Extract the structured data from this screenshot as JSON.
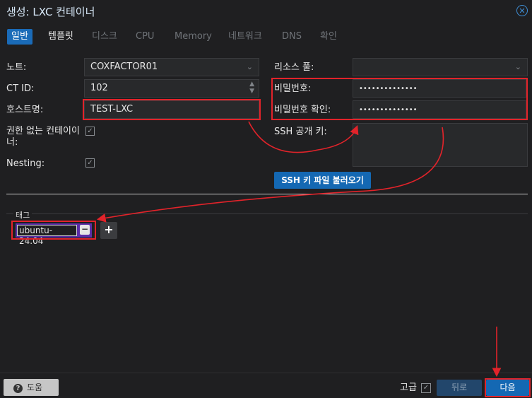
{
  "window": {
    "title": "생성: LXC 컨테이너"
  },
  "tabs": [
    {
      "label": "일반",
      "active": true
    },
    {
      "label": "템플릿",
      "active": false
    },
    {
      "label": "디스크",
      "active": false
    },
    {
      "label": "CPU",
      "active": false
    },
    {
      "label": "Memory",
      "active": false
    },
    {
      "label": "네트워크",
      "active": false
    },
    {
      "label": "DNS",
      "active": false
    },
    {
      "label": "확인",
      "active": false
    }
  ],
  "form": {
    "node": {
      "label": "노트:",
      "value": "COXFACTOR01"
    },
    "ctid": {
      "label": "CT ID:",
      "value": "102"
    },
    "hostname": {
      "label": "호스트명:",
      "value": "TEST-LXC"
    },
    "unprivileged": {
      "label": "권한 없는 컨테이너:",
      "label_line1": "권한 없는 컨테이이",
      "label_line2": "너:",
      "checked": true
    },
    "nesting": {
      "label": "Nesting:",
      "checked": true
    },
    "resource_pool": {
      "label": "리소스 풀:",
      "value": ""
    },
    "password": {
      "label": "비밀번호:",
      "value": "••••••••••••••"
    },
    "password_confirm": {
      "label": "비밀번호 확인:",
      "value": "••••••••••••••"
    },
    "ssh_key": {
      "label": "SSH 공개 키:",
      "value": ""
    },
    "load_ssh_button": "SSH 키 파일 불러오기"
  },
  "tags": {
    "legend": "태그",
    "items": [
      "ubuntu-24.04"
    ]
  },
  "footer": {
    "help_label": "도움",
    "advanced_label": "고급",
    "advanced_checked": true,
    "back_label": "뒤로",
    "next_label": "다음"
  },
  "colors": {
    "accent": "#1468b3",
    "annotation_red": "#e2232a",
    "tag_color": "#5c2ea8"
  }
}
